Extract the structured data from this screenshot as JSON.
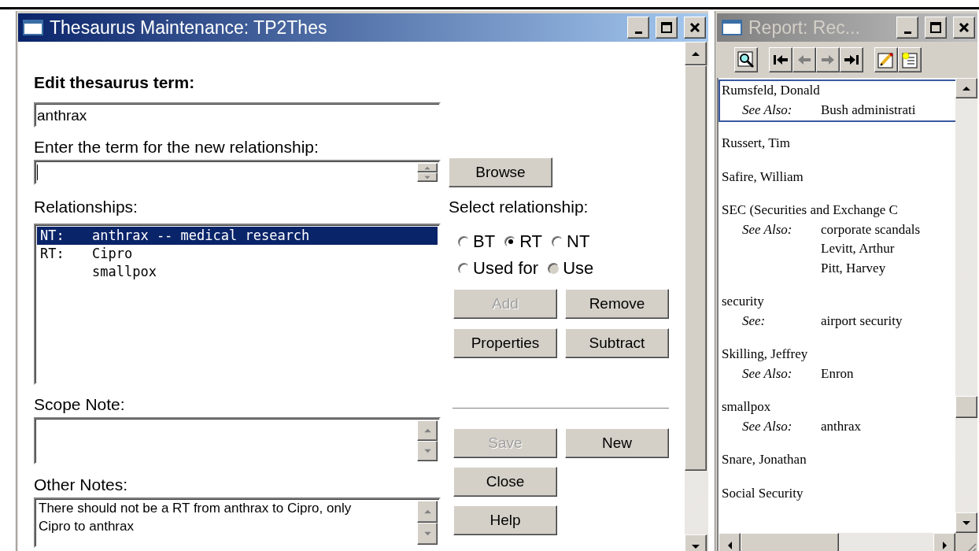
{
  "main_window": {
    "title": "Thesaurus Maintenance: TP2Thes",
    "active": true,
    "edit_label": "Edit thesaurus term:",
    "term_field": {
      "value": "anthrax"
    },
    "new_term_label": "Enter the term for the new relationship:",
    "browse_button": {
      "label": "Browse",
      "disabled": false
    },
    "relationships_label": "Relationships:",
    "relationships": [
      {
        "prefix": "NT:",
        "term": "anthrax -- medical research",
        "selected": true
      },
      {
        "prefix": "RT:",
        "term": "Cipro",
        "selected": false
      },
      {
        "term": "smallpox",
        "selected": false
      }
    ],
    "select_label": "Select relationship:",
    "radio_rows": [
      [
        {
          "label": "BT",
          "selected": false,
          "disabled": false
        },
        {
          "label": "RT",
          "selected": true,
          "disabled": false
        },
        {
          "label": "NT",
          "selected": false,
          "disabled": false
        }
      ],
      [
        {
          "label": "Used for",
          "selected": false,
          "disabled": false
        },
        {
          "label": "Use",
          "selected": false,
          "disabled": true
        }
      ]
    ],
    "relation_buttons": [
      [
        {
          "label": "Add",
          "disabled": true
        },
        {
          "label": "Remove",
          "disabled": false
        }
      ],
      [
        {
          "label": "Properties",
          "disabled": false
        },
        {
          "label": "Subtract",
          "disabled": false
        }
      ]
    ],
    "scope_label": "Scope Note:",
    "other_label": "Other Notes:",
    "other_notes": {
      "value": "There should not be a RT from anthrax to Cipro, only Cipro to anthrax"
    },
    "form_buttons": [
      [
        {
          "label": "Save",
          "disabled": true
        },
        {
          "label": "New",
          "disabled": false
        }
      ],
      [
        {
          "label": "Close",
          "disabled": false
        }
      ],
      [
        {
          "label": "Help",
          "disabled": false
        }
      ]
    ]
  },
  "report_window": {
    "title": "Report: Rec...",
    "active": false,
    "toolbar": [
      {
        "kind": "find",
        "disabled": false
      },
      {
        "kind": "first",
        "disabled": false
      },
      {
        "kind": "prev",
        "disabled": true
      },
      {
        "kind": "next",
        "disabled": true
      },
      {
        "kind": "last",
        "disabled": false
      },
      {
        "kind": "edit",
        "disabled": false
      },
      {
        "kind": "new",
        "disabled": false
      }
    ],
    "entries": [
      {
        "term": "Rumsfeld, Donald",
        "selected": true,
        "refs": [
          {
            "label": "See Also:",
            "targets": [
              "Bush administrati"
            ]
          }
        ]
      },
      {
        "term": "Russert, Tim",
        "selected": false
      },
      {
        "term": "Safire, William",
        "selected": false
      },
      {
        "term": "SEC (Securities and Exchange C",
        "selected": false,
        "refs": [
          {
            "label": "See Also:",
            "targets": [
              "corporate scandals",
              "Levitt, Arthur",
              "Pitt, Harvey"
            ]
          }
        ]
      },
      {
        "term": "security",
        "selected": false,
        "refs": [
          {
            "label": "See:",
            "targets": [
              "airport security"
            ]
          }
        ]
      },
      {
        "term": "Skilling, Jeffrey",
        "selected": false,
        "refs": [
          {
            "label": "See Also:",
            "targets": [
              "Enron"
            ]
          }
        ]
      },
      {
        "term": "smallpox",
        "selected": false,
        "refs": [
          {
            "label": "See Also:",
            "targets": [
              "anthrax"
            ]
          }
        ]
      },
      {
        "term": "Snare, Jonathan",
        "selected": false
      },
      {
        "term": "Social Security",
        "selected": false
      }
    ]
  }
}
